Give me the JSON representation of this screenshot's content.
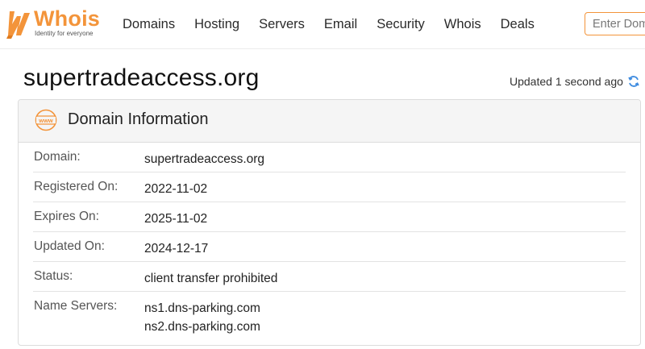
{
  "brand": {
    "name": "Whois",
    "tagline": "Identity for everyone",
    "accent": "#f3943a"
  },
  "nav": {
    "items": [
      "Domains",
      "Hosting",
      "Servers",
      "Email",
      "Security",
      "Whois",
      "Deals"
    ]
  },
  "search": {
    "placeholder": "Enter Domain"
  },
  "page": {
    "title": "supertradeaccess.org",
    "updated": "Updated 1 second ago"
  },
  "card": {
    "title": "Domain Information",
    "icon": "www-icon",
    "rows": [
      {
        "label": "Domain:",
        "value": "supertradeaccess.org"
      },
      {
        "label": "Registered On:",
        "value": "2022-11-02"
      },
      {
        "label": "Expires On:",
        "value": "2025-11-02"
      },
      {
        "label": "Updated On:",
        "value": "2024-12-17"
      },
      {
        "label": "Status:",
        "value": "client transfer prohibited"
      },
      {
        "label": "Name Servers:",
        "values": [
          "ns1.dns-parking.com",
          "ns2.dns-parking.com"
        ]
      }
    ]
  }
}
